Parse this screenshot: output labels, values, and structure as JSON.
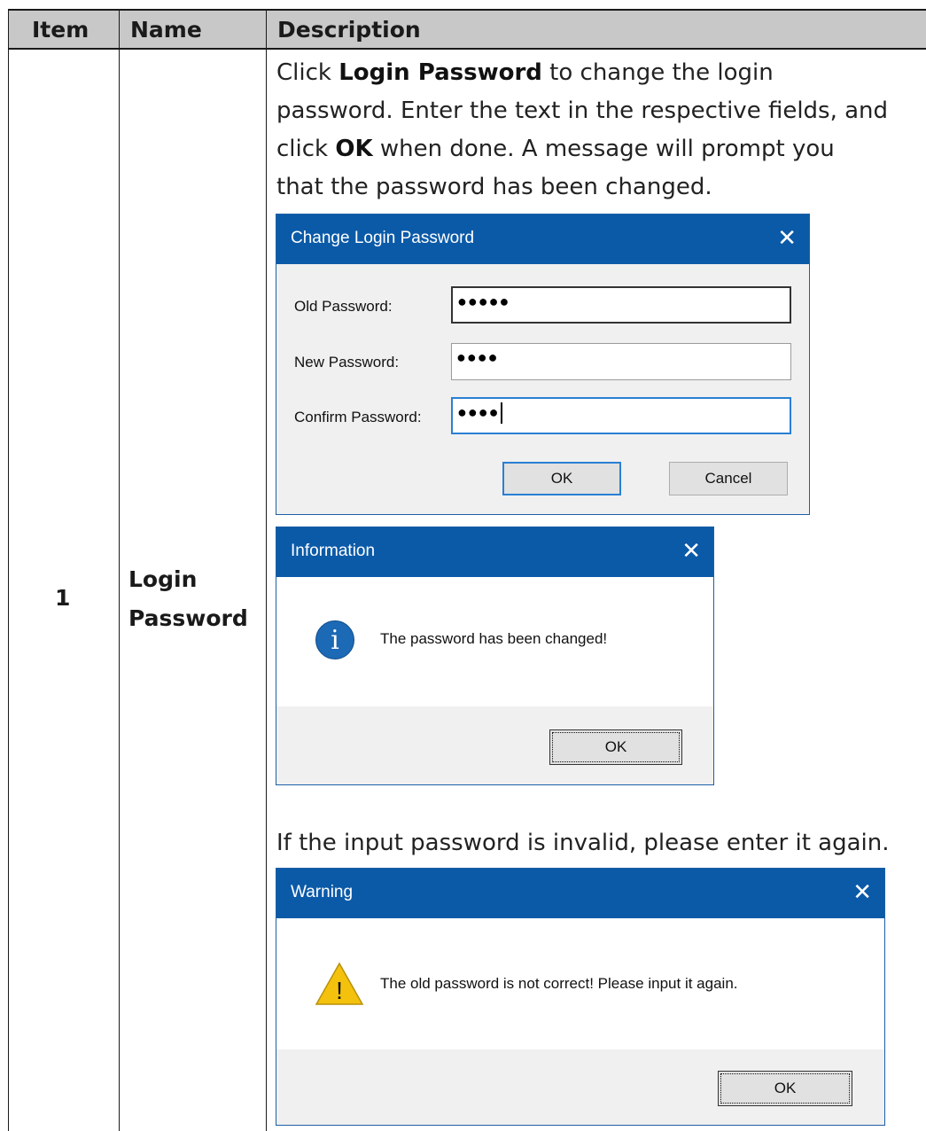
{
  "table": {
    "headers": {
      "item": "Item",
      "name": "Name",
      "description": "Description"
    },
    "row": {
      "item": "1",
      "name_line1": "Login",
      "name_line2": "Password",
      "desc1": {
        "l1_pre": "Click ",
        "l1_bold": "Login Password",
        "l1_post": " to change the login",
        "l2": "password. Enter the text in the respective fields, and",
        "l3_pre": "click ",
        "l3_bold": "OK",
        "l3_post": " when done. A message will prompt you",
        "l4": "that the password has been changed."
      },
      "desc2": "If the input password is invalid, please enter it again."
    }
  },
  "change_dialog": {
    "title": "Change Login Password",
    "close": "✕",
    "old_label": "Old Password:",
    "old_value": "●●●●●",
    "new_label": "New Password:",
    "new_value": "●●●●",
    "confirm_label": "Confirm Password:",
    "confirm_value": "●●●●",
    "ok": "OK",
    "cancel": "Cancel"
  },
  "info_dialog": {
    "title": "Information",
    "close": "✕",
    "icon_glyph": "i",
    "message": "The password has been changed!",
    "ok": "OK"
  },
  "warning_dialog": {
    "title": "Warning",
    "close": "✕",
    "icon_glyph": "!",
    "message": "The old password is not correct! Please input it again.",
    "ok": "OK"
  },
  "colors": {
    "titlebar": "#0b5aa8",
    "header_fill": "#c8c8c8",
    "info_icon": "#1c69b5",
    "warn_icon": "#f4c20d"
  }
}
